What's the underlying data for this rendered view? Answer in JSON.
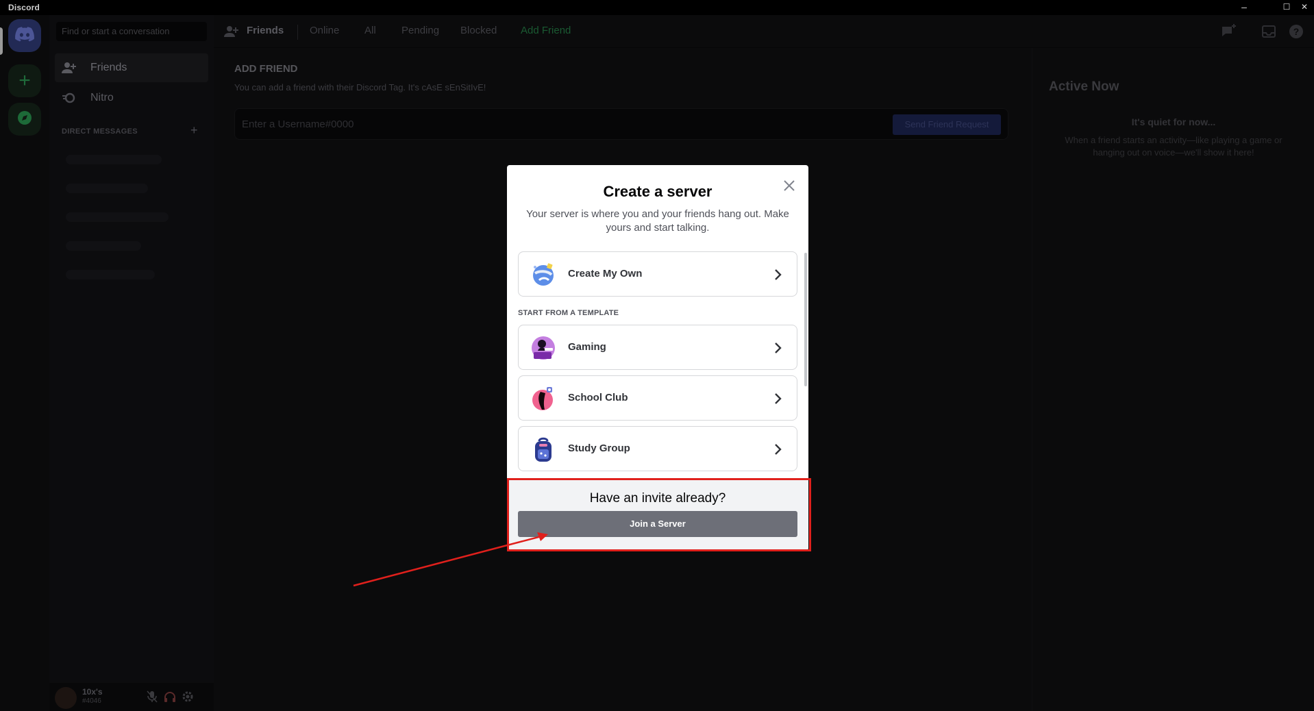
{
  "titlebar": {
    "app_name": "Discord",
    "minimize": "–",
    "maximize": "☐",
    "close": "✕"
  },
  "rail": {
    "home_icon": "discord-logo-icon",
    "add_server": "+",
    "explore_icon": "compass-icon"
  },
  "dm_sidebar": {
    "search_placeholder": "Find or start a conversation",
    "items": [
      {
        "label": "Friends",
        "icon": "friends-icon"
      },
      {
        "label": "Nitro",
        "icon": "nitro-icon"
      }
    ],
    "direct_messages_header": "DIRECT MESSAGES",
    "add_dm": "+",
    "user": {
      "name": "10x's",
      "tag": "#4046"
    }
  },
  "topnav": {
    "friends": "Friends",
    "tabs": [
      "Online",
      "All",
      "Pending",
      "Blocked"
    ],
    "add_friend": "Add Friend"
  },
  "add_friend": {
    "heading": "ADD FRIEND",
    "subtitle": "You can add a friend with their Discord Tag. It's cAsE sEnSitIvE!",
    "input_placeholder": "Enter a Username#0000",
    "send_button": "Send Friend Request"
  },
  "active_now": {
    "heading": "Active Now",
    "quiet_title": "It's quiet for now...",
    "quiet_desc": "When a friend starts an activity—like playing a game or hanging out on voice—we'll show it here!"
  },
  "modal": {
    "title": "Create a server",
    "description": "Your server is where you and your friends hang out. Make yours and start talking.",
    "create_own": "Create My Own",
    "template_header": "START FROM A TEMPLATE",
    "templates": [
      "Gaming",
      "School Club",
      "Study Group"
    ],
    "footer_title": "Have an invite already?",
    "join_button": "Join a Server"
  },
  "colors": {
    "highlight": "#e0201c",
    "join_button": "#6d6f78",
    "blurple": "#5865f2"
  }
}
